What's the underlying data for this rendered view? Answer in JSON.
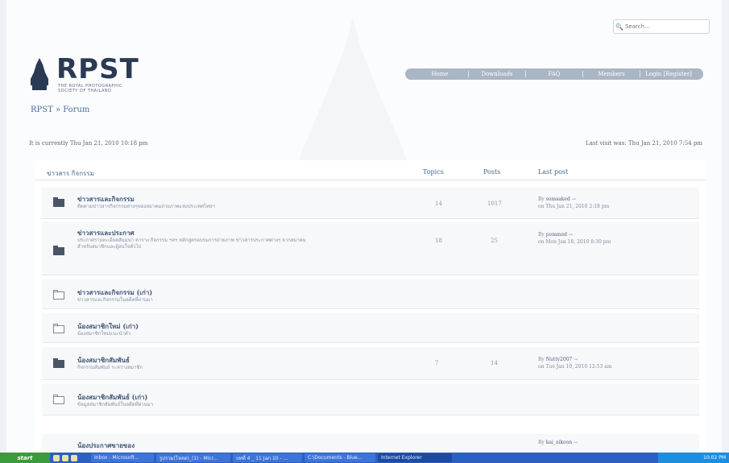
{
  "search": {
    "placeholder": "Search..."
  },
  "logo": {
    "text": "RPST",
    "sub_line1": "THE ROYAL PHOTOGRAPHIC",
    "sub_line2": "SOCIETY OF THAILAND"
  },
  "nav": [
    "Home",
    "Downloads",
    "FAQ",
    "Members",
    "Login [Register]"
  ],
  "site_title": "RPST » Forum",
  "time_current": "It is currently Thu Jan 21, 2010 10:18 pm",
  "time_last_visit": "Last visit was: Thu Jan 21, 2010 7:54 pm",
  "forum": {
    "category": "ข่าวสาร กิจกรรม",
    "col_topics": "Topics",
    "col_posts": "Posts",
    "col_last": "Last post",
    "rows": [
      {
        "title": "ข่าวสารและกิจกรรม",
        "desc": "ติดตามข่าวสารกิจกรรมต่างๆของสมาคมถ่ายภาพแห่งประเทศไทยฯ",
        "topics": "14",
        "posts": "1017",
        "last_by": "By",
        "last_user": "somsaked",
        "last_time": "on Thu Jan 21, 2010 2:18 pm",
        "icon": "folder-dark"
      },
      {
        "title": "ข่าวสารและประกาศ",
        "desc": "ประกาศรายละเอียดสัมมนา ตาราง กิจกรรม ฯลฯ หลักสูตรอบรมการถ่ายภาพ ข่าวสารประกาศต่างๆ จากสมาคม สำหรับสมาชิกและผู้สนใจทั่วไป",
        "topics": "18",
        "posts": "25",
        "last_by": "By",
        "last_user": "pommed",
        "last_time": "on Mon Jan 18, 2010 8:30 pm",
        "icon": "folder-dark"
      },
      {
        "title": "ข่าวสารและกิจกรรม (เก่า)",
        "desc": "ข่าวสารและกิจกรรมในอดีตที่ผ่านมา",
        "topics": "",
        "posts": "",
        "last_by": "",
        "last_user": "",
        "last_time": "",
        "icon": "folder-light"
      },
      {
        "title": "น้องสมาชิกใหม่ (เก่า)",
        "desc": "น้องสมาชิกใหม่แนะนำตัว",
        "topics": "",
        "posts": "",
        "last_by": "",
        "last_user": "",
        "last_time": "",
        "icon": "folder-light"
      },
      {
        "title": "น้องสมาชิกสัมพันธ์",
        "desc": "กิจกรรมสัมพันธ์ ระหว่างสมาชิก",
        "topics": "7",
        "posts": "14",
        "last_by": "By",
        "last_user": "Nutty2007",
        "last_time": "on Tue Jan 19, 2010 12:53 am",
        "icon": "folder-dark"
      },
      {
        "title": "น้องสมาชิกสัมพันธ์ (เก่า)",
        "desc": "ข้อมูลสมาชิกสัมพันธ์ในอดีตที่ผ่านมา",
        "topics": "",
        "posts": "",
        "last_by": "",
        "last_user": "",
        "last_time": "",
        "icon": "folder-light"
      },
      {
        "title": "น้องประกาศขายของ",
        "desc": "",
        "topics": "",
        "posts": "",
        "last_by": "By",
        "last_user": "kai_aikoon",
        "last_time": "",
        "icon": "folder-dark"
      }
    ]
  },
  "taskbar": {
    "start": "start",
    "items": [
      {
        "label": "Inbox - Microsoft...",
        "active": false
      },
      {
        "label": "รูปรวม(โหลด)_(1) - Micr...",
        "active": false
      },
      {
        "label": "บทที่ 4 _ 11 Jan 10 - ...",
        "active": false
      },
      {
        "label": "C:\\Documents - Blue...",
        "active": false
      },
      {
        "label": "Internet Explorer",
        "active": true
      }
    ],
    "clock": "10:02 PM"
  }
}
